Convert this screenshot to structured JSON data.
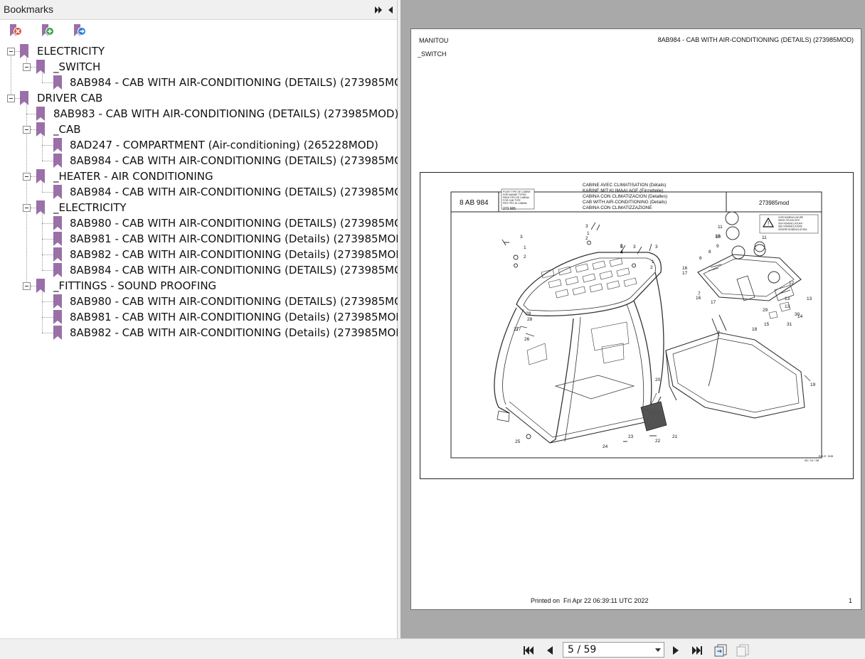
{
  "bookmarks_panel": {
    "title": "Bookmarks",
    "tools": [
      "delete-bookmark-icon",
      "add-bookmark-icon",
      "go-to-bookmark-icon"
    ],
    "items": [
      {
        "label": "ELECTRICITY",
        "level": 0
      },
      {
        "label": "_SWITCH",
        "level": 1
      },
      {
        "label": "8AB984 - CAB WITH AIR-CONDITIONING (DETAILS) (273985MOD)",
        "level": 2
      },
      {
        "label": "DRIVER CAB",
        "level": 0
      },
      {
        "label": "8AB983 - CAB WITH AIR-CONDITIONING (DETAILS) (273985MOD)",
        "level": 1
      },
      {
        "label": "_CAB",
        "level": 1
      },
      {
        "label": "8AD247 - COMPARTMENT (Air-conditioning) (265228MOD)",
        "level": 2
      },
      {
        "label": "8AB984 - CAB WITH AIR-CONDITIONING (DETAILS) (273985MOD)",
        "level": 2
      },
      {
        "label": "_HEATER - AIR CONDITIONING",
        "level": 1
      },
      {
        "label": "8AB984 - CAB WITH AIR-CONDITIONING (DETAILS) (273985MOD)",
        "level": 2
      },
      {
        "label": "_ELECTRICITY",
        "level": 1
      },
      {
        "label": "8AB980 - CAB WITH AIR-CONDITIONING (DETAILS) (273985MOD)",
        "level": 2
      },
      {
        "label": "8AB981 - CAB WITH AIR-CONDITIONING (Details) (273985MOD)",
        "level": 2
      },
      {
        "label": "8AB982 - CAB WITH AIR-CONDITIONING (Details) (273985MOD)",
        "level": 2
      },
      {
        "label": "8AB984 - CAB WITH AIR-CONDITIONING (DETAILS) (273985MOD)",
        "level": 2
      },
      {
        "label": "_FITTINGS - SOUND PROOFING",
        "level": 1
      },
      {
        "label": "8AB980 - CAB WITH AIR-CONDITIONING (DETAILS) (273985MOD)",
        "level": 2
      },
      {
        "label": "8AB981 - CAB WITH AIR-CONDITIONING (Details) (273985MOD)",
        "level": 2
      },
      {
        "label": "8AB982 - CAB WITH AIR-CONDITIONING (Details) (273985MOD)",
        "level": 2
      }
    ]
  },
  "document": {
    "brand": "MANITOU",
    "header_title": "8AB984 - CAB WITH AIR-CONDITIONING (DETAILS) (273985MOD)",
    "section": "_SWITCH",
    "printed_label": "Printed on",
    "printed_date": "Fri Apr 22 06:39:11 UTC 2022",
    "page_number": "1",
    "drawing": {
      "code": "8 AB 984",
      "ref": "273985mod",
      "titles": [
        "CABINE AVEC CLIMATISATION (Détails)",
        "KABINE MIT KLIMAALAGE (Einzelteile)",
        "CABINA CON CLIMATIZACION (Detalles)",
        "CAB WITH AIR-CONDITIONING (Details)",
        "CABINA CON CLIMATIZZAZIONE"
      ],
      "box_lines": [
        "POUR TYPE DE CABINE",
        "FÜR KABINE TYPEN",
        "PARA TIPO DE CABINA",
        "FOR CAB TYPE",
        "PER TIPO DI CABINA"
      ],
      "box_ref": "273 965",
      "warn_lines": [
        "VOIR NOMENCLATURE",
        "SIEHE STÜCKLISTE",
        "VER NOMENCLATURA",
        "SEE NOMENCLATURE",
        "VEDERE NOMENCLATURA"
      ],
      "side_code": "B.A.E. 3/45",
      "date_code": "08 / 10 / 08",
      "callouts": [
        "1",
        "2",
        "3",
        "4",
        "5",
        "6",
        "7",
        "8",
        "9",
        "10",
        "11",
        "12",
        "13",
        "14",
        "15",
        "16",
        "17",
        "18",
        "19",
        "20",
        "21",
        "22",
        "23",
        "24",
        "25",
        "26",
        "27",
        "28",
        "29",
        "30",
        "31"
      ]
    }
  },
  "nav": {
    "page_display": "5 / 59",
    "buttons": [
      "first-page-icon",
      "prev-page-icon",
      "next-page-icon",
      "last-page-icon",
      "fit-page-icon",
      "continuous-icon"
    ]
  },
  "colors": {
    "bookmark": "#9b6fa8",
    "viewer_bg": "#a9a9a9"
  }
}
